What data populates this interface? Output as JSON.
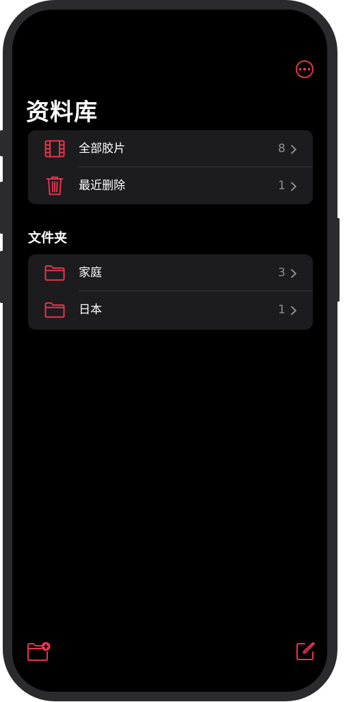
{
  "nav": {
    "more_icon": "ellipsis-circle-icon"
  },
  "page": {
    "title": "资料库"
  },
  "library": {
    "items": [
      {
        "label": "全部胶片",
        "count": "8",
        "icon": "film-icon"
      },
      {
        "label": "最近删除",
        "count": "1",
        "icon": "trash-icon"
      }
    ]
  },
  "folders": {
    "header": "文件夹",
    "items": [
      {
        "label": "家庭",
        "count": "3",
        "icon": "folder-icon"
      },
      {
        "label": "日本",
        "count": "1",
        "icon": "folder-icon"
      }
    ]
  },
  "toolbar": {
    "new_folder_icon": "folder-add-icon",
    "compose_icon": "compose-icon"
  },
  "colors": {
    "accent": "#e8344f",
    "background": "#000000",
    "card": "#1c1c1e",
    "secondary_text": "#8e8e93",
    "separator": "#38383a"
  }
}
